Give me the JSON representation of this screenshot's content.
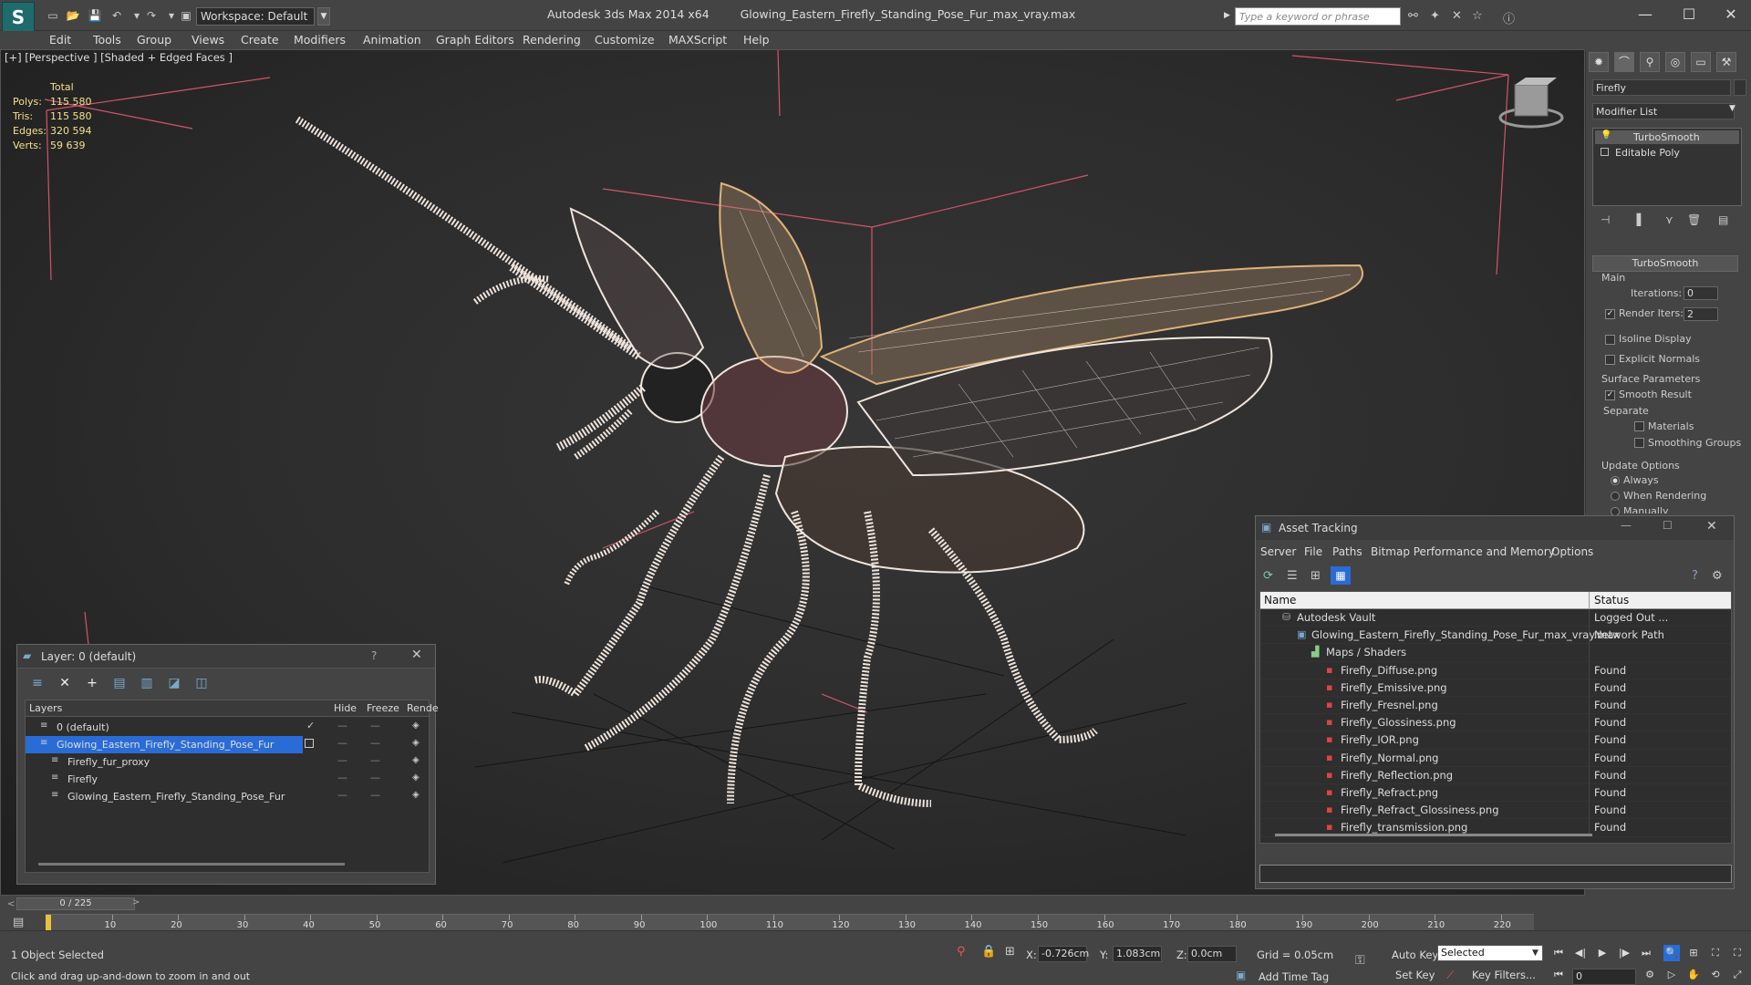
{
  "app": {
    "title_app": "Autodesk 3ds Max  2014 x64",
    "title_file": "Glowing_Eastern_Firefly_Standing_Pose_Fur_max_vray.max",
    "workspace": "Workspace: Default",
    "search_placeholder": "Type a keyword or phrase"
  },
  "menu": [
    "Edit",
    "Tools",
    "Group",
    "Views",
    "Create",
    "Modifiers",
    "Animation",
    "Graph Editors",
    "Rendering",
    "Customize",
    "MAXScript",
    "Help"
  ],
  "viewport": {
    "label": "[+] [Perspective ] [Shaded + Edged Faces ]",
    "stats_header": "Total",
    "stats": [
      {
        "label": "Polys:",
        "value": "115 580"
      },
      {
        "label": "Tris:",
        "value": "115 580"
      },
      {
        "label": "Edges:",
        "value": "320 594"
      },
      {
        "label": "Verts:",
        "value": "59 639"
      }
    ]
  },
  "command_panel": {
    "object_name": "Firefly",
    "modifier_list": "Modifier List",
    "stack": [
      "TurboSmooth",
      "Editable Poly"
    ],
    "rollout_title": "TurboSmooth",
    "main_group": "Main",
    "iterations_label": "Iterations:",
    "iterations_value": "0",
    "render_iters_label": "Render Iters:",
    "render_iters_value": "2",
    "isoline_label": "Isoline Display",
    "explicit_normals_label": "Explicit Normals",
    "surface_group": "Surface Parameters",
    "smooth_result_label": "Smooth Result",
    "separate_label": "Separate",
    "materials_label": "Materials",
    "smoothing_groups_label": "Smoothing Groups",
    "update_group": "Update Options",
    "update_options": [
      "Always",
      "When Rendering",
      "Manually"
    ]
  },
  "layer_window": {
    "title": "Layer: 0 (default)",
    "help": "?",
    "columns": [
      "Layers",
      "Hide",
      "Freeze",
      "Rende"
    ],
    "rows": [
      {
        "name": "0 (default)",
        "indent": 1,
        "selected": false
      },
      {
        "name": "Glowing_Eastern_Firefly_Standing_Pose_Fur",
        "indent": 1,
        "selected": true
      },
      {
        "name": "Firefly_fur_proxy",
        "indent": 2,
        "selected": false
      },
      {
        "name": "Firefly",
        "indent": 2,
        "selected": false
      },
      {
        "name": "Glowing_Eastern_Firefly_Standing_Pose_Fur",
        "indent": 2,
        "selected": false
      }
    ]
  },
  "asset_window": {
    "title": "Asset Tracking",
    "menu": [
      "Server",
      "File",
      "Paths",
      "Bitmap Performance and Memory",
      "Options"
    ],
    "columns": [
      "Name",
      "Status"
    ],
    "rows": [
      {
        "name": "Autodesk Vault",
        "status": "Logged Out ...",
        "indent": 1,
        "icon": "vault"
      },
      {
        "name": "Glowing_Eastern_Firefly_Standing_Pose_Fur_max_vray.max",
        "status": "Network Path",
        "indent": 2,
        "icon": "max"
      },
      {
        "name": "Maps / Shaders",
        "status": "",
        "indent": 3,
        "icon": "folder"
      },
      {
        "name": "Firefly_Diffuse.png",
        "status": "Found",
        "indent": 4,
        "icon": "png"
      },
      {
        "name": "Firefly_Emissive.png",
        "status": "Found",
        "indent": 4,
        "icon": "png"
      },
      {
        "name": "Firefly_Fresnel.png",
        "status": "Found",
        "indent": 4,
        "icon": "png"
      },
      {
        "name": "Firefly_Glossiness.png",
        "status": "Found",
        "indent": 4,
        "icon": "png"
      },
      {
        "name": "Firefly_IOR.png",
        "status": "Found",
        "indent": 4,
        "icon": "png"
      },
      {
        "name": "Firefly_Normal.png",
        "status": "Found",
        "indent": 4,
        "icon": "png"
      },
      {
        "name": "Firefly_Reflection.png",
        "status": "Found",
        "indent": 4,
        "icon": "png"
      },
      {
        "name": "Firefly_Refract.png",
        "status": "Found",
        "indent": 4,
        "icon": "png"
      },
      {
        "name": "Firefly_Refract_Glossiness.png",
        "status": "Found",
        "indent": 4,
        "icon": "png"
      },
      {
        "name": "Firefly_transmission.png",
        "status": "Found",
        "indent": 4,
        "icon": "png"
      }
    ]
  },
  "timeline": {
    "frame": "0 / 225",
    "ticks": [
      0,
      10,
      20,
      30,
      40,
      50,
      60,
      70,
      80,
      90,
      100,
      110,
      120,
      130,
      140,
      150,
      160,
      170,
      180,
      190,
      200,
      210,
      220
    ],
    "tick_labels": [
      "10",
      "20",
      "30",
      "40",
      "50",
      "60",
      "70",
      "80",
      "90",
      "100",
      "110",
      "120",
      "130",
      "140",
      "150",
      "160",
      "170",
      "180",
      "190",
      "200",
      "210",
      "220"
    ]
  },
  "status": {
    "selected": "1 Object Selected",
    "prompt": "Click and drag up-and-down to zoom in and out",
    "x_label": "X:",
    "x_value": "-0.726cm",
    "y_label": "Y:",
    "y_value": "1.083cm",
    "z_label": "Z:",
    "z_value": "0.0cm",
    "grid": "Grid = 0.05cm",
    "auto_key": "Auto Key",
    "selected_dropdown": "Selected",
    "set_key": "Set Key",
    "key_filters": "Key Filters...",
    "add_time_tag": "Add Time Tag",
    "frame_field": "0"
  },
  "colors": {
    "accent": "#2a6cd6",
    "found": "#dddddd",
    "wire": "#f0e6de",
    "wire_orange": "#d8a060",
    "stats_text": "#f2e28a"
  }
}
